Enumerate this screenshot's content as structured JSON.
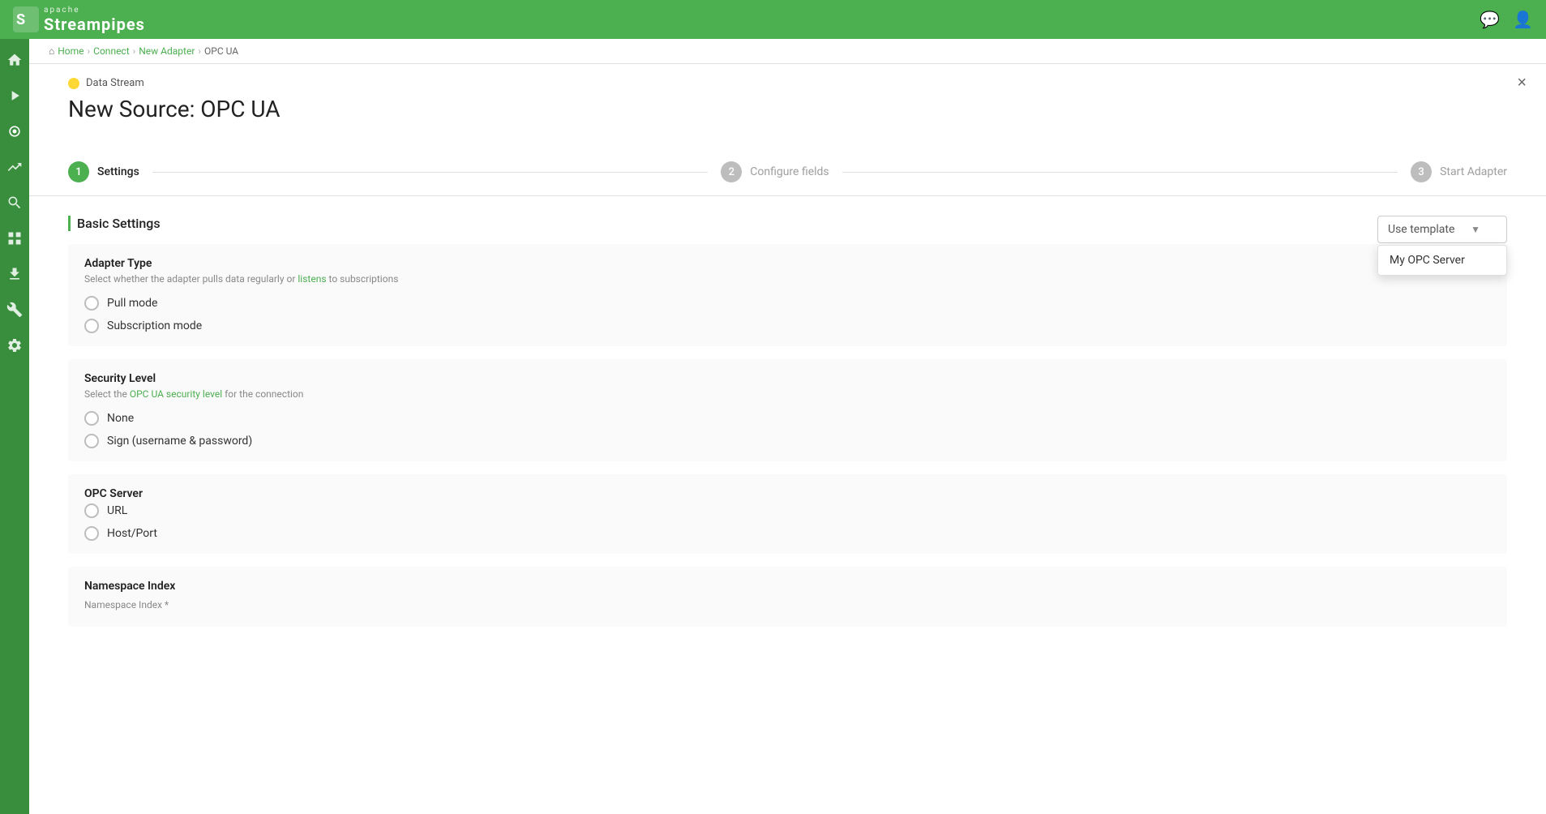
{
  "topbar": {
    "logo_apache": "apache",
    "logo_name": "Streampipes",
    "icon_chat": "💬",
    "icon_user": "👤"
  },
  "sidebar": {
    "items": [
      {
        "id": "home",
        "icon": "⌂",
        "label": "Home"
      },
      {
        "id": "pipeline",
        "icon": "▶",
        "label": "Pipeline"
      },
      {
        "id": "connect",
        "icon": "🔌",
        "label": "Connect",
        "active": true
      },
      {
        "id": "analytics",
        "icon": "📊",
        "label": "Analytics"
      },
      {
        "id": "search",
        "icon": "🔍",
        "label": "Search"
      },
      {
        "id": "grid",
        "icon": "⊞",
        "label": "Grid"
      },
      {
        "id": "download",
        "icon": "⬇",
        "label": "Download"
      },
      {
        "id": "wrench",
        "icon": "🔧",
        "label": "Wrench"
      },
      {
        "id": "settings",
        "icon": "⚙",
        "label": "Settings"
      }
    ]
  },
  "breadcrumb": {
    "home": "Home",
    "connect": "Connect",
    "new_adapter": "New Adapter",
    "current": "OPC UA"
  },
  "page": {
    "badge": "Data Stream",
    "title": "New Source: OPC UA",
    "close_label": "×"
  },
  "stepper": {
    "steps": [
      {
        "number": "1",
        "label": "Settings",
        "active": true
      },
      {
        "number": "2",
        "label": "Configure fields",
        "active": false
      },
      {
        "number": "3",
        "label": "Start Adapter",
        "active": false
      }
    ]
  },
  "template_dropdown": {
    "placeholder": "Use template",
    "arrow": "▼",
    "options": [
      {
        "label": "My OPC Server"
      }
    ]
  },
  "basic_settings": {
    "section_title": "Basic Settings",
    "field_groups": [
      {
        "id": "adapter-type",
        "title": "Adapter Type",
        "description": "Select whether the adapter pulls data regularly or listens to subscriptions",
        "options": [
          {
            "id": "pull-mode",
            "label": "Pull mode"
          },
          {
            "id": "subscription-mode",
            "label": "Subscription mode"
          }
        ]
      },
      {
        "id": "security-level",
        "title": "Security Level",
        "description": "Select the OPC UA security level for the connection",
        "options": [
          {
            "id": "none",
            "label": "None"
          },
          {
            "id": "sign",
            "label": "Sign (username & password)"
          }
        ]
      },
      {
        "id": "opc-server",
        "title": "OPC Server",
        "description": null,
        "options": [
          {
            "id": "url",
            "label": "URL"
          },
          {
            "id": "host-port",
            "label": "Host/Port"
          }
        ]
      },
      {
        "id": "namespace-index",
        "title": "Namespace Index",
        "description": null,
        "field_label": "Namespace Index *",
        "options": []
      }
    ]
  }
}
